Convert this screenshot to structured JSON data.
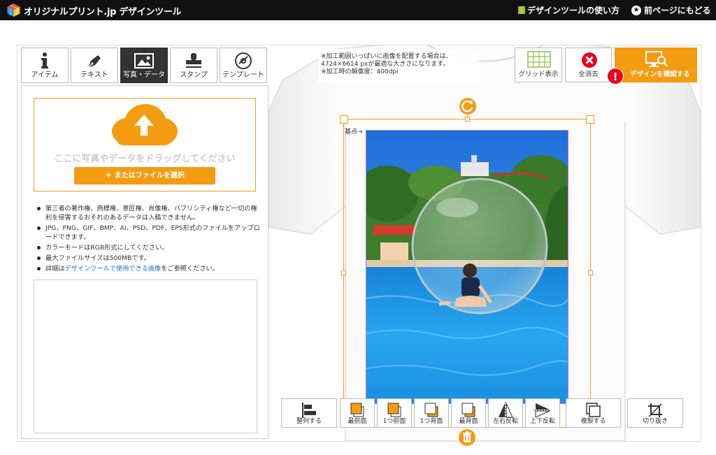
{
  "header": {
    "logo_text": "オリジナルプリント.jp デザインツール",
    "howto_label": "デザインツールの使い方",
    "back_label": "前ページにもどる"
  },
  "tabs": [
    {
      "label": "アイテム",
      "icon": "info-icon"
    },
    {
      "label": "テキスト",
      "icon": "pen-icon"
    },
    {
      "label": "写真・データ",
      "icon": "image-icon",
      "active": true
    },
    {
      "label": "スタンプ",
      "icon": "stamp-icon"
    },
    {
      "label": "テンプレート",
      "icon": "disc-icon"
    }
  ],
  "upload": {
    "drop_text": "ここに写真やデータをドラッグしてください",
    "file_button": "＋ またはファイルを選択"
  },
  "notes": {
    "item1": "第三者の著作権、商標権、意匠権、肖像権、パブリシティ権など一切の権利を侵害するおそれのあるデータは入稿できません。",
    "item2": "JPG、PNG、GIF、BMP、AI、PSD、PDF、EPS形式のファイルをアップロードできます。",
    "item3": "カラーモードはRGB形式にしてください。",
    "item4": "最大ファイルサイズは500MBです。",
    "item5_pre": "詳細は",
    "item5_link": "デザインツールで使用できる画像",
    "item5_post": "をご参照ください。"
  },
  "canvas_note": {
    "line1": "※加工範囲いっぱいに画像を配置する場合は、",
    "line2": "4724×6614 pxが最適な大きさになります。",
    "line3": "※加工時の解像度：400dpi"
  },
  "toolbar_top": {
    "grid_label": "グリッド表示",
    "clear_label": "全消去",
    "confirm_label": "デザインを確認する"
  },
  "base_label": "基点→",
  "bottom_tools": {
    "align": "整列する",
    "front": "最前面",
    "forward": "1つ前面",
    "backward": "1つ背面",
    "back": "最背面",
    "flip_h": "左右反転",
    "flip_v": "上下反転",
    "duplicate": "複製する",
    "crop": "切り抜き"
  },
  "colors": {
    "accent": "#f39c12",
    "alert": "#e3071d",
    "header_bg": "#111111"
  }
}
